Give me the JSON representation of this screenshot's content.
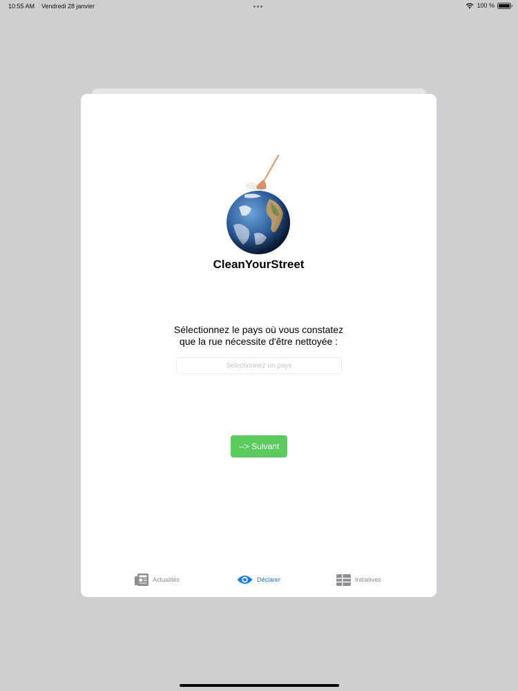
{
  "status_bar": {
    "time": "10:55 AM",
    "date": "Vendredi 28 janvier",
    "battery": "100 %"
  },
  "app": {
    "title": "CleanYourStreet",
    "logo_icon": "globe-with-broom-icon"
  },
  "form": {
    "prompt_line1": "Sélectionnez le pays où vous constatez",
    "prompt_line2": "que la rue nécessite d'être nettoyée :",
    "country_placeholder": "Selectionnez un pays",
    "country_value": "",
    "next_label": "--> Suivant"
  },
  "tabs": [
    {
      "label": "Actualités",
      "icon": "newspaper-icon",
      "active": false
    },
    {
      "label": "Déclarer",
      "icon": "eye-icon",
      "active": true
    },
    {
      "label": "Initiatives",
      "icon": "table-icon",
      "active": false
    }
  ],
  "colors": {
    "background": "#cfced0",
    "accent_green": "#5ccb5f",
    "tab_active": "#1a7ae5",
    "tab_inactive": "#8e8e93"
  }
}
